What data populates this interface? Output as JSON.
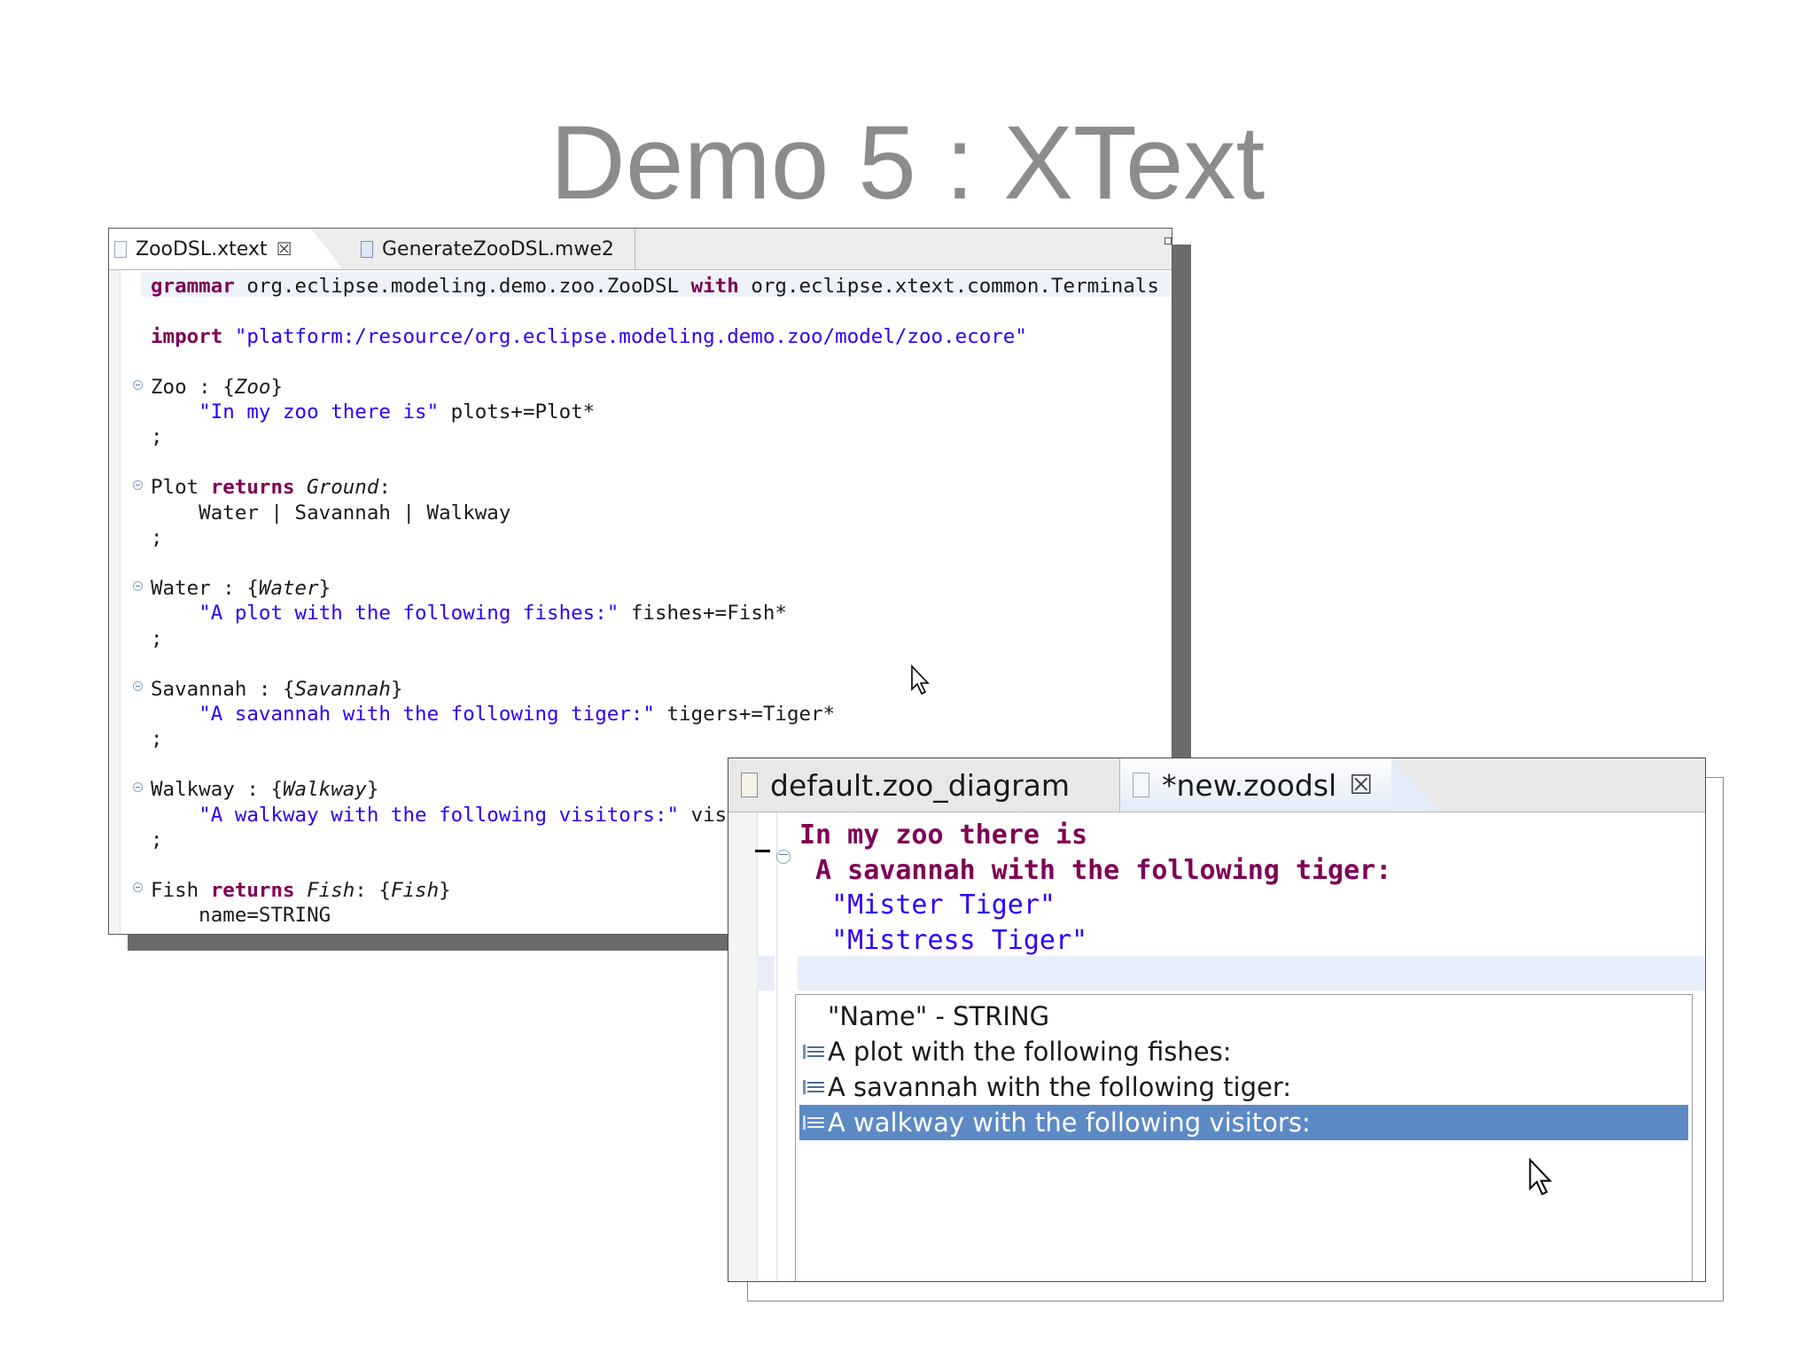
{
  "slide_title": "Demo 5 : XText",
  "editor1": {
    "tabs": [
      {
        "label": "ZooDSL.xtext",
        "close": "☒",
        "active": true
      },
      {
        "label": "GenerateZooDSL.mwe2",
        "active": false
      }
    ],
    "lines": [
      [
        {
          "t": "grammar",
          "c": "kw"
        },
        {
          "t": " org.eclipse.modeling.demo.zoo.ZooDSL "
        },
        {
          "t": "with",
          "c": "kw"
        },
        {
          "t": " org.eclipse.xtext.common.Terminals"
        }
      ],
      [],
      [
        {
          "t": "import",
          "c": "kw"
        },
        {
          "t": " "
        },
        {
          "t": "\"platform:/resource/org.eclipse.modeling.demo.zoo/model/zoo.ecore\"",
          "c": "str"
        }
      ],
      [],
      [
        {
          "t": "Zoo : {"
        },
        {
          "t": "Zoo",
          "c": "it"
        },
        {
          "t": "}"
        }
      ],
      [
        {
          "t": "    "
        },
        {
          "t": "\"In my zoo there is\"",
          "c": "str"
        },
        {
          "t": " plots+=Plot*"
        }
      ],
      [
        {
          "t": ";"
        }
      ],
      [],
      [
        {
          "t": "Plot "
        },
        {
          "t": "returns",
          "c": "kw"
        },
        {
          "t": " "
        },
        {
          "t": "Ground",
          "c": "it"
        },
        {
          "t": ":"
        }
      ],
      [
        {
          "t": "    Water | Savannah | Walkway"
        }
      ],
      [
        {
          "t": ";"
        }
      ],
      [],
      [
        {
          "t": "Water : {"
        },
        {
          "t": "Water",
          "c": "it"
        },
        {
          "t": "}"
        }
      ],
      [
        {
          "t": "    "
        },
        {
          "t": "\"A plot with the following fishes:\"",
          "c": "str"
        },
        {
          "t": " fishes+=Fish*"
        }
      ],
      [
        {
          "t": ";"
        }
      ],
      [],
      [
        {
          "t": "Savannah : {"
        },
        {
          "t": "Savannah",
          "c": "it"
        },
        {
          "t": "}"
        }
      ],
      [
        {
          "t": "    "
        },
        {
          "t": "\"A savannah with the following tiger:\"",
          "c": "str"
        },
        {
          "t": " tigers+=Tiger*"
        }
      ],
      [
        {
          "t": ";"
        }
      ],
      [],
      [
        {
          "t": "Walkway : {"
        },
        {
          "t": "Walkway",
          "c": "it"
        },
        {
          "t": "}"
        }
      ],
      [
        {
          "t": "    "
        },
        {
          "t": "\"A walkway with the following visitors:\"",
          "c": "str"
        },
        {
          "t": " visi"
        }
      ],
      [
        {
          "t": ";"
        }
      ],
      [],
      [
        {
          "t": "Fish "
        },
        {
          "t": "returns",
          "c": "kw"
        },
        {
          "t": " "
        },
        {
          "t": "Fish",
          "c": "it"
        },
        {
          "t": ": {"
        },
        {
          "t": "Fish",
          "c": "it"
        },
        {
          "t": "}"
        }
      ],
      [
        {
          "t": "    name=STRING"
        }
      ]
    ]
  },
  "editor2": {
    "tabs": [
      {
        "label": "default.zoo_diagram",
        "active": false
      },
      {
        "label": "*new.zoodsl",
        "close": "☒",
        "active": true
      }
    ],
    "lines": [
      [
        {
          "t": "In my zoo there is",
          "c": "kw"
        }
      ],
      [
        {
          "t": " A savannah with the following tiger:",
          "c": "kw"
        }
      ],
      [
        {
          "t": "  "
        },
        {
          "t": "\"Mister Tiger\"",
          "c": "str"
        }
      ],
      [
        {
          "t": "  "
        },
        {
          "t": "\"Mistress Tiger\"",
          "c": "str"
        }
      ]
    ],
    "proposals": [
      {
        "label": "\"Name\" - STRING",
        "icon": false,
        "selected": false
      },
      {
        "label": "A plot with the following fishes:",
        "icon": true,
        "selected": false
      },
      {
        "label": "A savannah with the following tiger:",
        "icon": true,
        "selected": false
      },
      {
        "label": "A walkway with the following visitors:",
        "icon": true,
        "selected": true
      }
    ]
  }
}
